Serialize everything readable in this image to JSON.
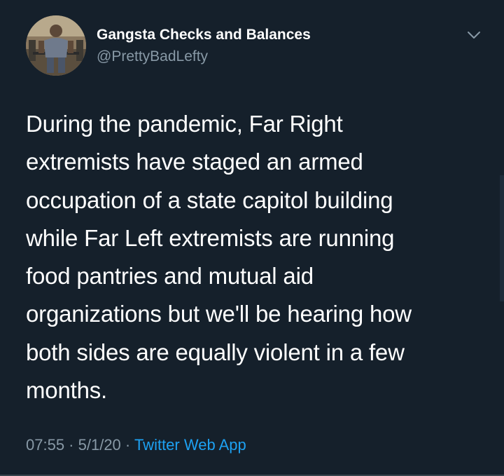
{
  "tweet": {
    "author": {
      "display_name": "Gangsta Checks and Balances",
      "handle": "@PrettyBadLefty",
      "avatar_icon": "user-avatar-photo"
    },
    "menu_icon": "chevron-down-icon",
    "text_lines": [
      "During the pandemic, Far Right",
      "extremists have staged an armed",
      "occupation of a state capitol building",
      "while Far Left extremists are running",
      "food pantries and mutual aid",
      "organizations but we'll be hearing how",
      "both sides are equally violent in a few",
      "months."
    ],
    "meta": {
      "time": "07:55",
      "separator": " · ",
      "date": "5/1/20",
      "source": "Twitter Web App"
    }
  },
  "colors": {
    "background": "#15202b",
    "primary_text": "#ffffff",
    "secondary_text": "#8899a6",
    "accent": "#1da1f2"
  }
}
